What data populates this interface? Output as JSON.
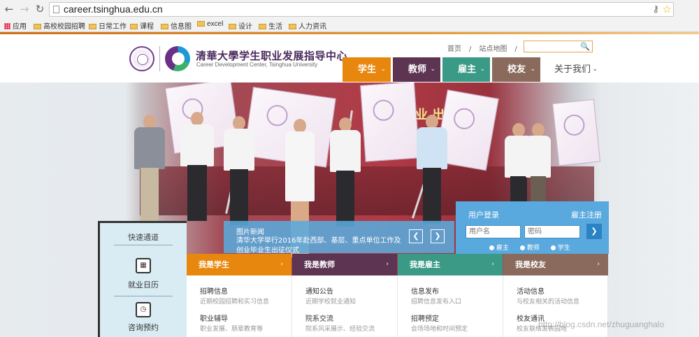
{
  "browser": {
    "url": "career.tsinghua.edu.cn",
    "bookmarks": [
      "应用",
      "高校校园招聘",
      "日常工作",
      "课程",
      "信息图",
      "excel",
      "设计",
      "生活",
      "人力资讯"
    ]
  },
  "site": {
    "name_cn": "学生职业发展指导中心",
    "name_en": "Career Development Center, Tsinghua University",
    "top_links": [
      "首页",
      "/",
      "站点地图",
      "/"
    ],
    "nav": [
      {
        "label": "学生",
        "color": "#e8870e"
      },
      {
        "label": "教师",
        "color": "#5d3552"
      },
      {
        "label": "雇主",
        "color": "#3a9a86"
      },
      {
        "label": "校友",
        "color": "#8a6a5c"
      },
      {
        "label": "关于我们"
      }
    ]
  },
  "banner": {
    "title": "作及创业      出征仪式"
  },
  "news": {
    "label": "图片新闻",
    "text": "清华大学举行2016年赴西部、基层、重点单位工作及创业毕业生出征仪式"
  },
  "login": {
    "title": "用户登录",
    "register": "雇主注册",
    "username_placeholder": "用户名",
    "password_placeholder": "密码",
    "roles": [
      "雇主",
      "教师",
      "学生"
    ]
  },
  "quick": {
    "title": "快速通道",
    "items": [
      "就业日历",
      "咨询预约"
    ]
  },
  "panels": [
    {
      "title": "我是学生",
      "color": "#e8870e",
      "items": [
        {
          "a": "招聘信息",
          "b": "近期校园招聘和实习信息"
        },
        {
          "a": "职业辅导",
          "b": "职业发展、朋辈教育等"
        }
      ]
    },
    {
      "title": "我是教师",
      "color": "#5d3552",
      "items": [
        {
          "a": "通知公告",
          "b": "近期学校就业通知"
        },
        {
          "a": "院系交流",
          "b": "院系风采展示、经验交流"
        }
      ]
    },
    {
      "title": "我是雇主",
      "color": "#3a9a86",
      "items": [
        {
          "a": "信息发布",
          "b": "招聘信息发布入口"
        },
        {
          "a": "招聘预定",
          "b": "会场场地和时间预定"
        }
      ]
    },
    {
      "title": "我是校友",
      "color": "#8a6a5c",
      "items": [
        {
          "a": "活动信息",
          "b": "与校友相关的活动信息"
        },
        {
          "a": "校友通讯",
          "b": "校友联络发表园地"
        }
      ]
    }
  ],
  "watermark": "http://blog.csdn.net/zhuguanghalo"
}
